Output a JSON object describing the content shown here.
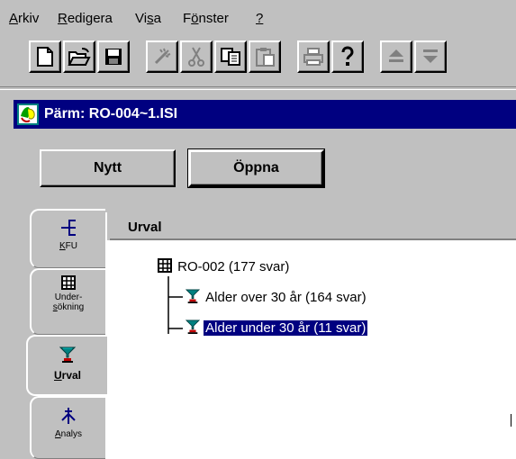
{
  "menu": {
    "items": [
      {
        "id": "arkiv",
        "pre": "",
        "acc": "A",
        "post": "rkiv"
      },
      {
        "id": "redigera",
        "pre": "",
        "acc": "R",
        "post": "edigera"
      },
      {
        "id": "visa",
        "pre": "Vi",
        "acc": "s",
        "post": "a"
      },
      {
        "id": "fonster",
        "pre": "F",
        "acc": "ö",
        "post": "nster"
      },
      {
        "id": "help",
        "pre": "",
        "acc": "?",
        "post": ""
      }
    ]
  },
  "toolbar": {
    "buttons": [
      "new-document",
      "open-folder",
      "save-disk",
      "magic-wand",
      "cut-scissors",
      "copy",
      "paste",
      "print",
      "help-question",
      "move-up",
      "move-down"
    ]
  },
  "window": {
    "title": "Pärm: RO-004~1.ISI"
  },
  "actions": {
    "new_label": "Nytt",
    "open_label": "Öppna"
  },
  "tabs": [
    {
      "id": "kfu",
      "label_pre": "",
      "label_acc": "K",
      "label_post": "FU",
      "icon": "kfu-icon"
    },
    {
      "id": "undersokning",
      "label_line1": "Under-",
      "label_pre": "",
      "label_acc": "s",
      "label_post": "ökning",
      "icon": "grid-icon"
    },
    {
      "id": "urval",
      "label_pre": "",
      "label_acc": "U",
      "label_post": "rval",
      "icon": "filter-icon",
      "active": true
    },
    {
      "id": "analys",
      "label_pre": "",
      "label_acc": "A",
      "label_post": "nalys",
      "icon": "analysis-icon"
    }
  ],
  "panel": {
    "title": "Urval",
    "tree": {
      "root": "RO-002 (177 svar)",
      "children": [
        {
          "label": "Alder over 30 år (164 svar)",
          "selected": false
        },
        {
          "label": "Alder under 30 år (11 svar)",
          "selected": true
        }
      ]
    }
  }
}
